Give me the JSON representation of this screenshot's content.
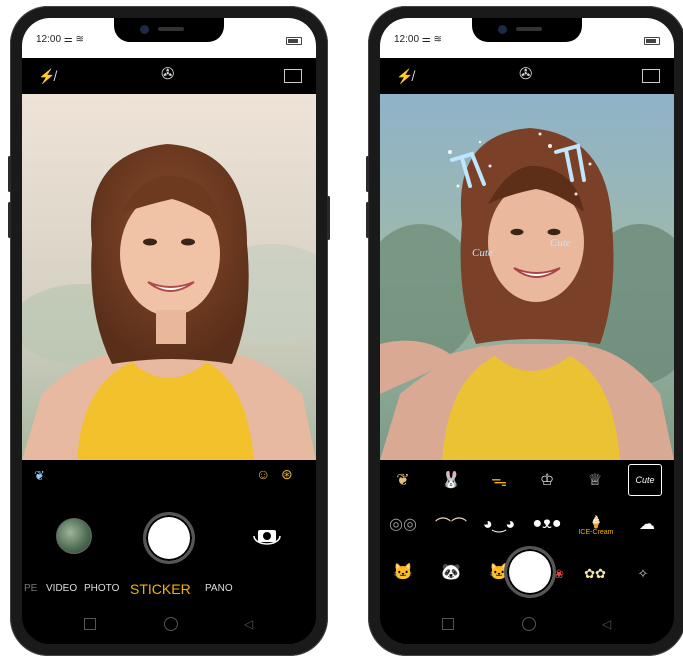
{
  "left_phone": {
    "status": {
      "time": "12:00"
    },
    "top_icons": [
      "flash-off-icon",
      "aperture-icon",
      "aspect-ratio-icon"
    ],
    "side_icons": [
      "beauty-icon",
      "face-filter-icon",
      "color-filter-icon"
    ],
    "modes": [
      "VIDEO",
      "PHOTO",
      "STICKER",
      "PANO"
    ],
    "active_mode": "STICKER",
    "accent": "#f0b400"
  },
  "right_phone": {
    "status": {
      "time": "12:00"
    },
    "top_icons": [
      "flash-off-icon",
      "aperture-icon",
      "aspect-ratio-icon"
    ],
    "face_overlay_text": "Cute",
    "sticker_rows": [
      [
        "bow-sticker",
        "bunny-ears-sticker",
        "bee-sticker",
        "crown-sticker",
        "tiara-sticker",
        "cute-cat-sticker"
      ],
      [
        "glasses-sticker",
        "rabbit-ears-sticker",
        "cat-eyes-sticker",
        "panda-eyes-sticker",
        "ice-cream-sticker",
        "cloud-sticker"
      ],
      [
        "cat-face-sticker",
        "panda-sticker",
        "cat-head-sticker",
        "cherry-sticker",
        "flowers-sticker",
        "sparkle-sticker"
      ]
    ],
    "ice_cream_label": "ICE-Cream"
  }
}
